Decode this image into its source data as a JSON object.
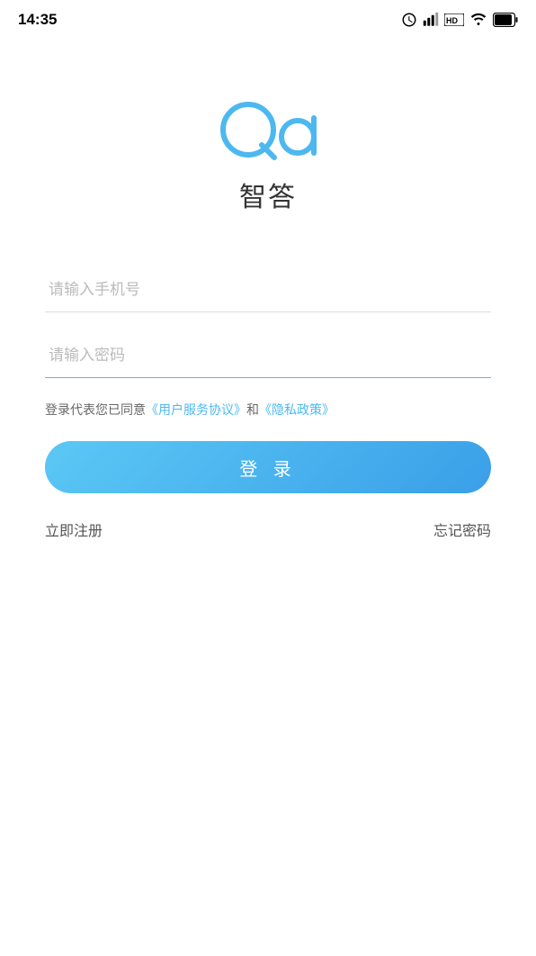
{
  "statusBar": {
    "time": "14:35"
  },
  "logo": {
    "appName": "智答"
  },
  "form": {
    "phonePlaceholder": "请输入手机号",
    "passwordPlaceholder": "请输入密码"
  },
  "agreement": {
    "prefix": "登录代表您已同意",
    "serviceLink": "《用户服务协议》",
    "connector": "和",
    "privacyLink": "《隐私政策》"
  },
  "loginButton": {
    "label": "登 录"
  },
  "bottomLinks": {
    "register": "立即注册",
    "forgotPassword": "忘记密码"
  }
}
